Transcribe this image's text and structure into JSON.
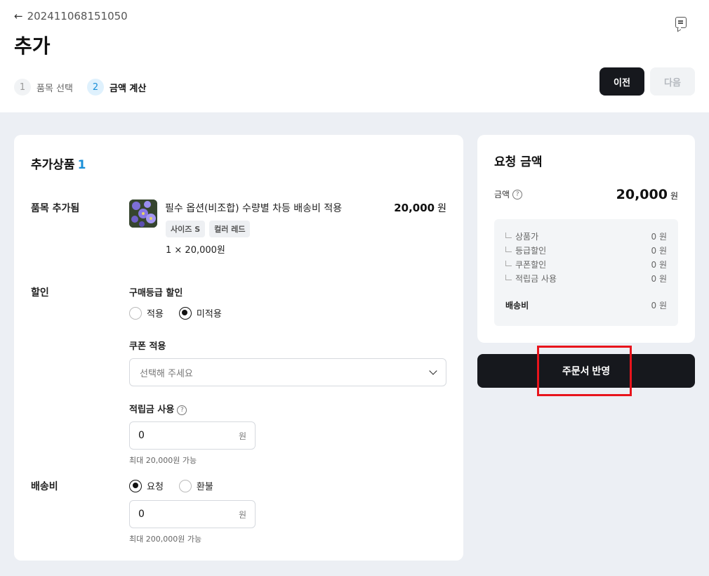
{
  "header": {
    "back_arrow": "←",
    "order_id": "202411068151050",
    "title": "추가",
    "feedback_icon": "message-square-icon"
  },
  "steps": [
    {
      "num": "1",
      "label": "품목 선택",
      "state": "inactive"
    },
    {
      "num": "2",
      "label": "금액 계산",
      "state": "active"
    }
  ],
  "nav": {
    "prev_label": "이전",
    "next_label": "다음"
  },
  "added_products": {
    "title": "추가상품",
    "count": "1",
    "row_label": "품목 추가됨",
    "item": {
      "name": "필수 옵션(비조합) 수량별 차등 배송비 적용",
      "price": "20,000",
      "price_unit": "원",
      "chips": [
        "사이즈 S",
        "컬러 레드"
      ],
      "qty_line": "1 × 20,000원"
    }
  },
  "discount": {
    "row_label": "할인",
    "grade_label": "구매등급 할인",
    "grade_options": [
      {
        "label": "적용",
        "checked": false
      },
      {
        "label": "미적용",
        "checked": true
      }
    ],
    "coupon_label": "쿠폰 적용",
    "coupon_placeholder": "선택해 주세요",
    "points_label": "적립금 사용",
    "points_value": "0",
    "points_unit": "원",
    "points_hint": "최대 20,000원 가능"
  },
  "shipping": {
    "row_label": "배송비",
    "options": [
      {
        "label": "요청",
        "checked": true
      },
      {
        "label": "환불",
        "checked": false
      }
    ],
    "value": "0",
    "unit": "원",
    "hint": "최대 200,000원 가능"
  },
  "summary": {
    "title": "요청 금액",
    "amount_label": "금액",
    "help_glyph": "?",
    "amount_value": "20,000",
    "amount_unit": "원",
    "breakdown": [
      {
        "label": "상품가",
        "value": "0 원"
      },
      {
        "label": "등급할인",
        "value": "0 원"
      },
      {
        "label": "쿠폰할인",
        "value": "0 원"
      },
      {
        "label": "적립금 사용",
        "value": "0 원"
      }
    ],
    "shipping_label": "배송비",
    "shipping_value": "0 원"
  },
  "reflect_button": "주문서 반영",
  "colors": {
    "accent": "#1a8fd8",
    "dark_button": "#16181d",
    "highlight": "#e8141c",
    "page_bg": "#eceff4"
  }
}
